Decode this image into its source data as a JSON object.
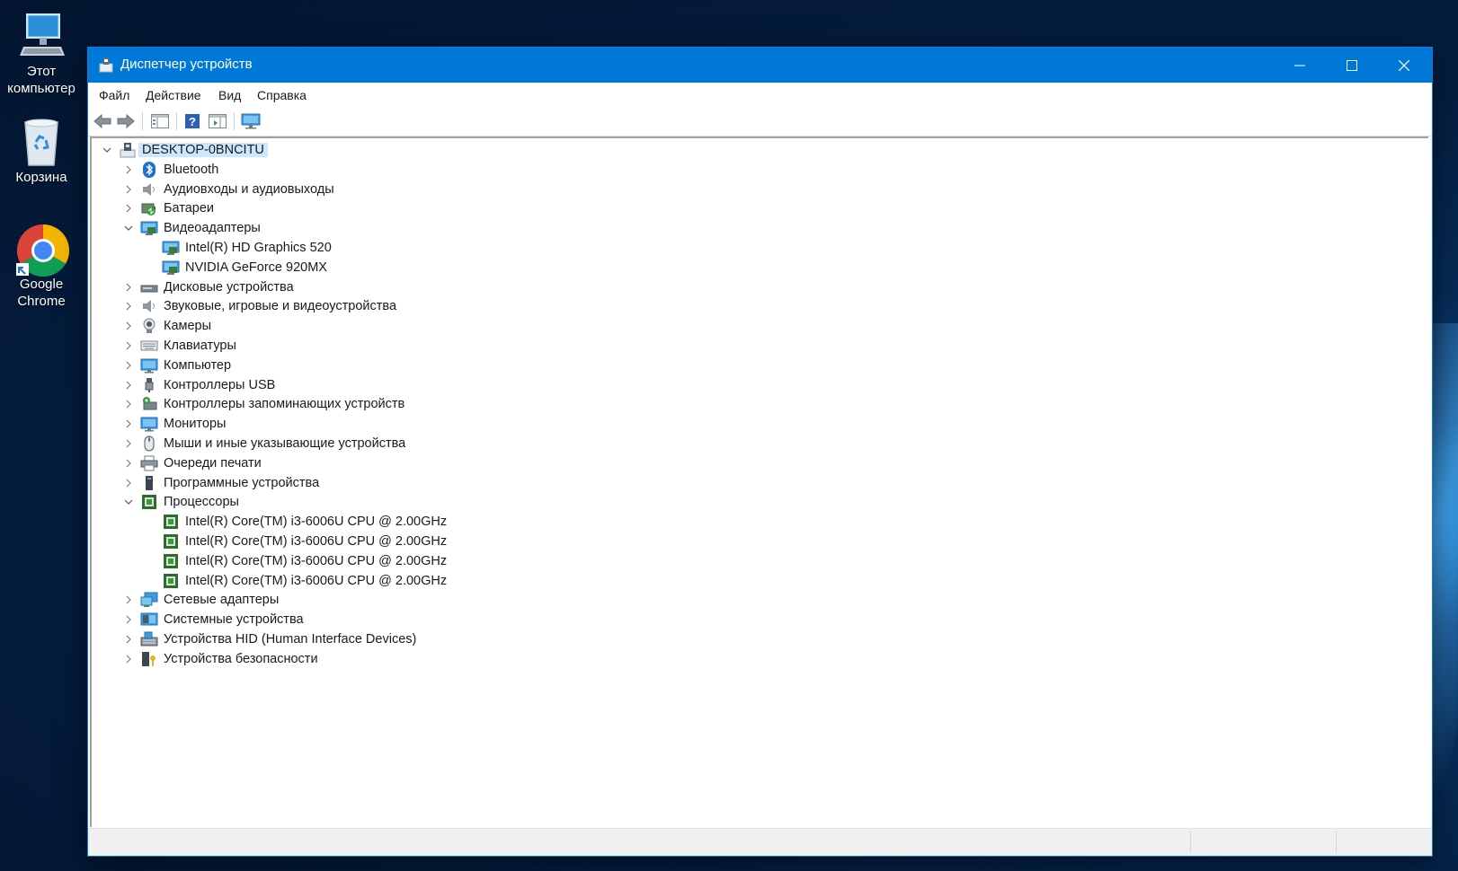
{
  "desktop": {
    "icons": [
      {
        "label_line1": "Этот",
        "label_line2": "компьютер"
      },
      {
        "label_line1": "Корзина",
        "label_line2": ""
      },
      {
        "label_line1": "Google",
        "label_line2": "Chrome"
      }
    ]
  },
  "window": {
    "title": "Диспетчер устройств",
    "menu": [
      "Файл",
      "Действие",
      "Вид",
      "Справка"
    ]
  },
  "tree": {
    "root": "DESKTOP-0BNCITU",
    "nodes": [
      {
        "label": "Bluetooth",
        "icon": "bluetooth-icon"
      },
      {
        "label": "Аудиовходы и аудиовыходы",
        "icon": "speaker-icon"
      },
      {
        "label": "Батареи",
        "icon": "battery-icon"
      },
      {
        "label": "Видеоадаптеры",
        "icon": "display-adapter-icon",
        "expanded": true,
        "children": [
          "Intel(R) HD Graphics 520",
          "NVIDIA GeForce 920MX"
        ]
      },
      {
        "label": "Дисковые устройства",
        "icon": "disk-drive-icon"
      },
      {
        "label": "Звуковые, игровые и видеоустройства",
        "icon": "speaker-icon"
      },
      {
        "label": "Камеры",
        "icon": "camera-icon"
      },
      {
        "label": "Клавиатуры",
        "icon": "keyboard-icon"
      },
      {
        "label": "Компьютер",
        "icon": "monitor-icon"
      },
      {
        "label": "Контроллеры USB",
        "icon": "usb-icon"
      },
      {
        "label": "Контроллеры запоминающих устройств",
        "icon": "storage-controller-icon"
      },
      {
        "label": "Мониторы",
        "icon": "monitor-icon"
      },
      {
        "label": "Мыши и иные указывающие устройства",
        "icon": "mouse-icon"
      },
      {
        "label": "Очереди печати",
        "icon": "printer-icon"
      },
      {
        "label": "Программные устройства",
        "icon": "software-device-icon"
      },
      {
        "label": "Процессоры",
        "icon": "cpu-icon",
        "expanded": true,
        "children": [
          "Intel(R) Core(TM) i3-6006U CPU @ 2.00GHz",
          "Intel(R) Core(TM) i3-6006U CPU @ 2.00GHz",
          "Intel(R) Core(TM) i3-6006U CPU @ 2.00GHz",
          "Intel(R) Core(TM) i3-6006U CPU @ 2.00GHz"
        ]
      },
      {
        "label": "Сетевые адаптеры",
        "icon": "network-adapter-icon"
      },
      {
        "label": "Системные устройства",
        "icon": "system-device-icon"
      },
      {
        "label": "Устройства HID (Human Interface Devices)",
        "icon": "hid-icon"
      },
      {
        "label": "Устройства безопасности",
        "icon": "security-device-icon"
      }
    ]
  },
  "colors": {
    "titlebar": "#0078d7",
    "selection": "#cce8ff"
  }
}
